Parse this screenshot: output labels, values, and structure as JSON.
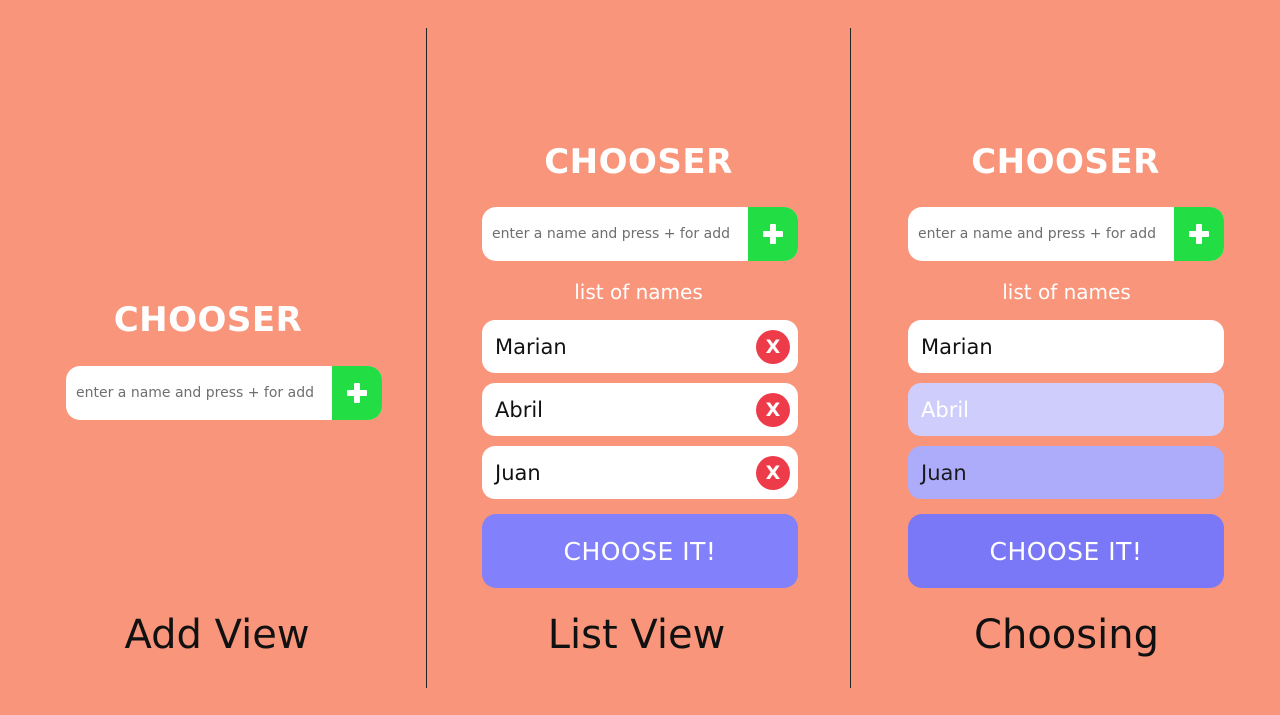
{
  "colors": {
    "background": "#f8957a",
    "add_button": "#22dd44",
    "remove_button": "#ee3b4a",
    "choose_button": "#8280fa",
    "faded_item": "#cfcdfb",
    "chosen_item": "#acacfb"
  },
  "icons": {
    "add": "plus-icon",
    "remove": "x-icon"
  },
  "panels": [
    {
      "caption": "Add View",
      "title": "CHOOSER",
      "input_placeholder": "enter a name and press + for add"
    },
    {
      "caption": "List View",
      "title": "CHOOSER",
      "input_placeholder": "enter a name and press + for add",
      "list_label": "list of names",
      "names": [
        "Marian",
        "Abril",
        "Juan"
      ],
      "remove_label": "X",
      "choose_label": "CHOOSE IT!"
    },
    {
      "caption": "Choosing",
      "title": "CHOOSER",
      "input_placeholder": "enter a name and press + for add",
      "list_label": "list of names",
      "names": [
        "Marian",
        "Abril",
        "Juan"
      ],
      "choose_label": "CHOOSE IT!"
    }
  ]
}
